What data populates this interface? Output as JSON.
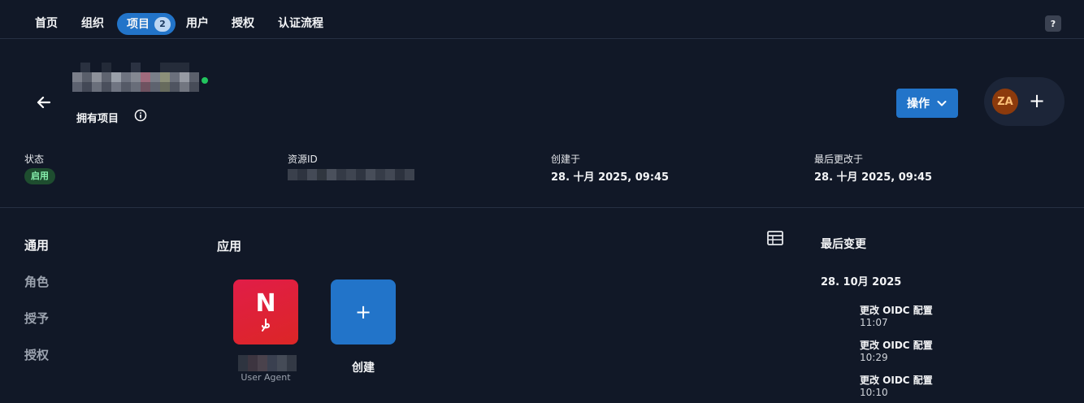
{
  "nav": {
    "items": [
      {
        "label": "首页"
      },
      {
        "label": "组织"
      },
      {
        "label": "项目",
        "badge": "2",
        "active": true
      },
      {
        "label": "用户"
      },
      {
        "label": "授权"
      },
      {
        "label": "认证流程"
      }
    ],
    "help_label": "?"
  },
  "header": {
    "subtitle": "拥有项目",
    "action_label": "操作",
    "avatar_initials": "ZA",
    "add_label": "+"
  },
  "meta": {
    "status_label": "状态",
    "status_value": "启用",
    "resource_label": "资源ID",
    "created_label": "创建于",
    "created_value": "28. 十月 2025, 09:45",
    "modified_label": "最后更改于",
    "modified_value": "28. 十月 2025, 09:45"
  },
  "sidenav": {
    "items": [
      {
        "label": "通用",
        "active": true
      },
      {
        "label": "角色"
      },
      {
        "label": "授予"
      },
      {
        "label": "授权"
      }
    ]
  },
  "apps": {
    "title": "应用",
    "items": [
      {
        "letter": "N",
        "type": "User Agent"
      }
    ],
    "create_symbol": "+",
    "create_label": "创建"
  },
  "activity": {
    "title": "最后变更",
    "date": "28. 10月 2025",
    "entries": [
      {
        "text": "更改 OIDC 配置",
        "time": "11:07"
      },
      {
        "text": "更改 OIDC 配置",
        "time": "10:29"
      },
      {
        "text": "更改 OIDC 配置",
        "time": "10:10"
      }
    ]
  },
  "colors": {
    "background": "#111827",
    "accent": "#2274c9",
    "status_green": "#22c55e"
  }
}
